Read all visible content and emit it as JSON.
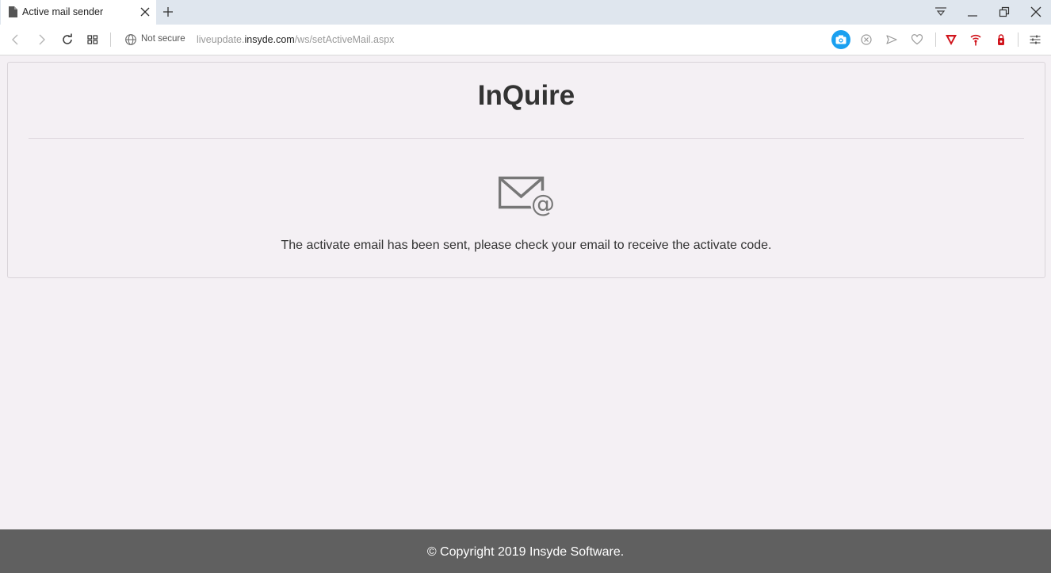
{
  "browser": {
    "tab": {
      "title": "Active mail sender"
    },
    "address": {
      "security_label": "Not secure",
      "url_prefix": "liveupdate.",
      "url_host": "insyde.com",
      "url_path": "/ws/setActiveMail.aspx"
    }
  },
  "page": {
    "title": "InQuire",
    "icon": "mail-at-icon",
    "message": "The activate email has been sent, please check your email to receive the activate code.",
    "footer": "© Copyright 2019 Insyde Software."
  },
  "colors": {
    "page_background": "#f4f0f4",
    "footer_background": "#606060",
    "camera_accent": "#1aa0f0",
    "brand_red": "#d0141c"
  }
}
